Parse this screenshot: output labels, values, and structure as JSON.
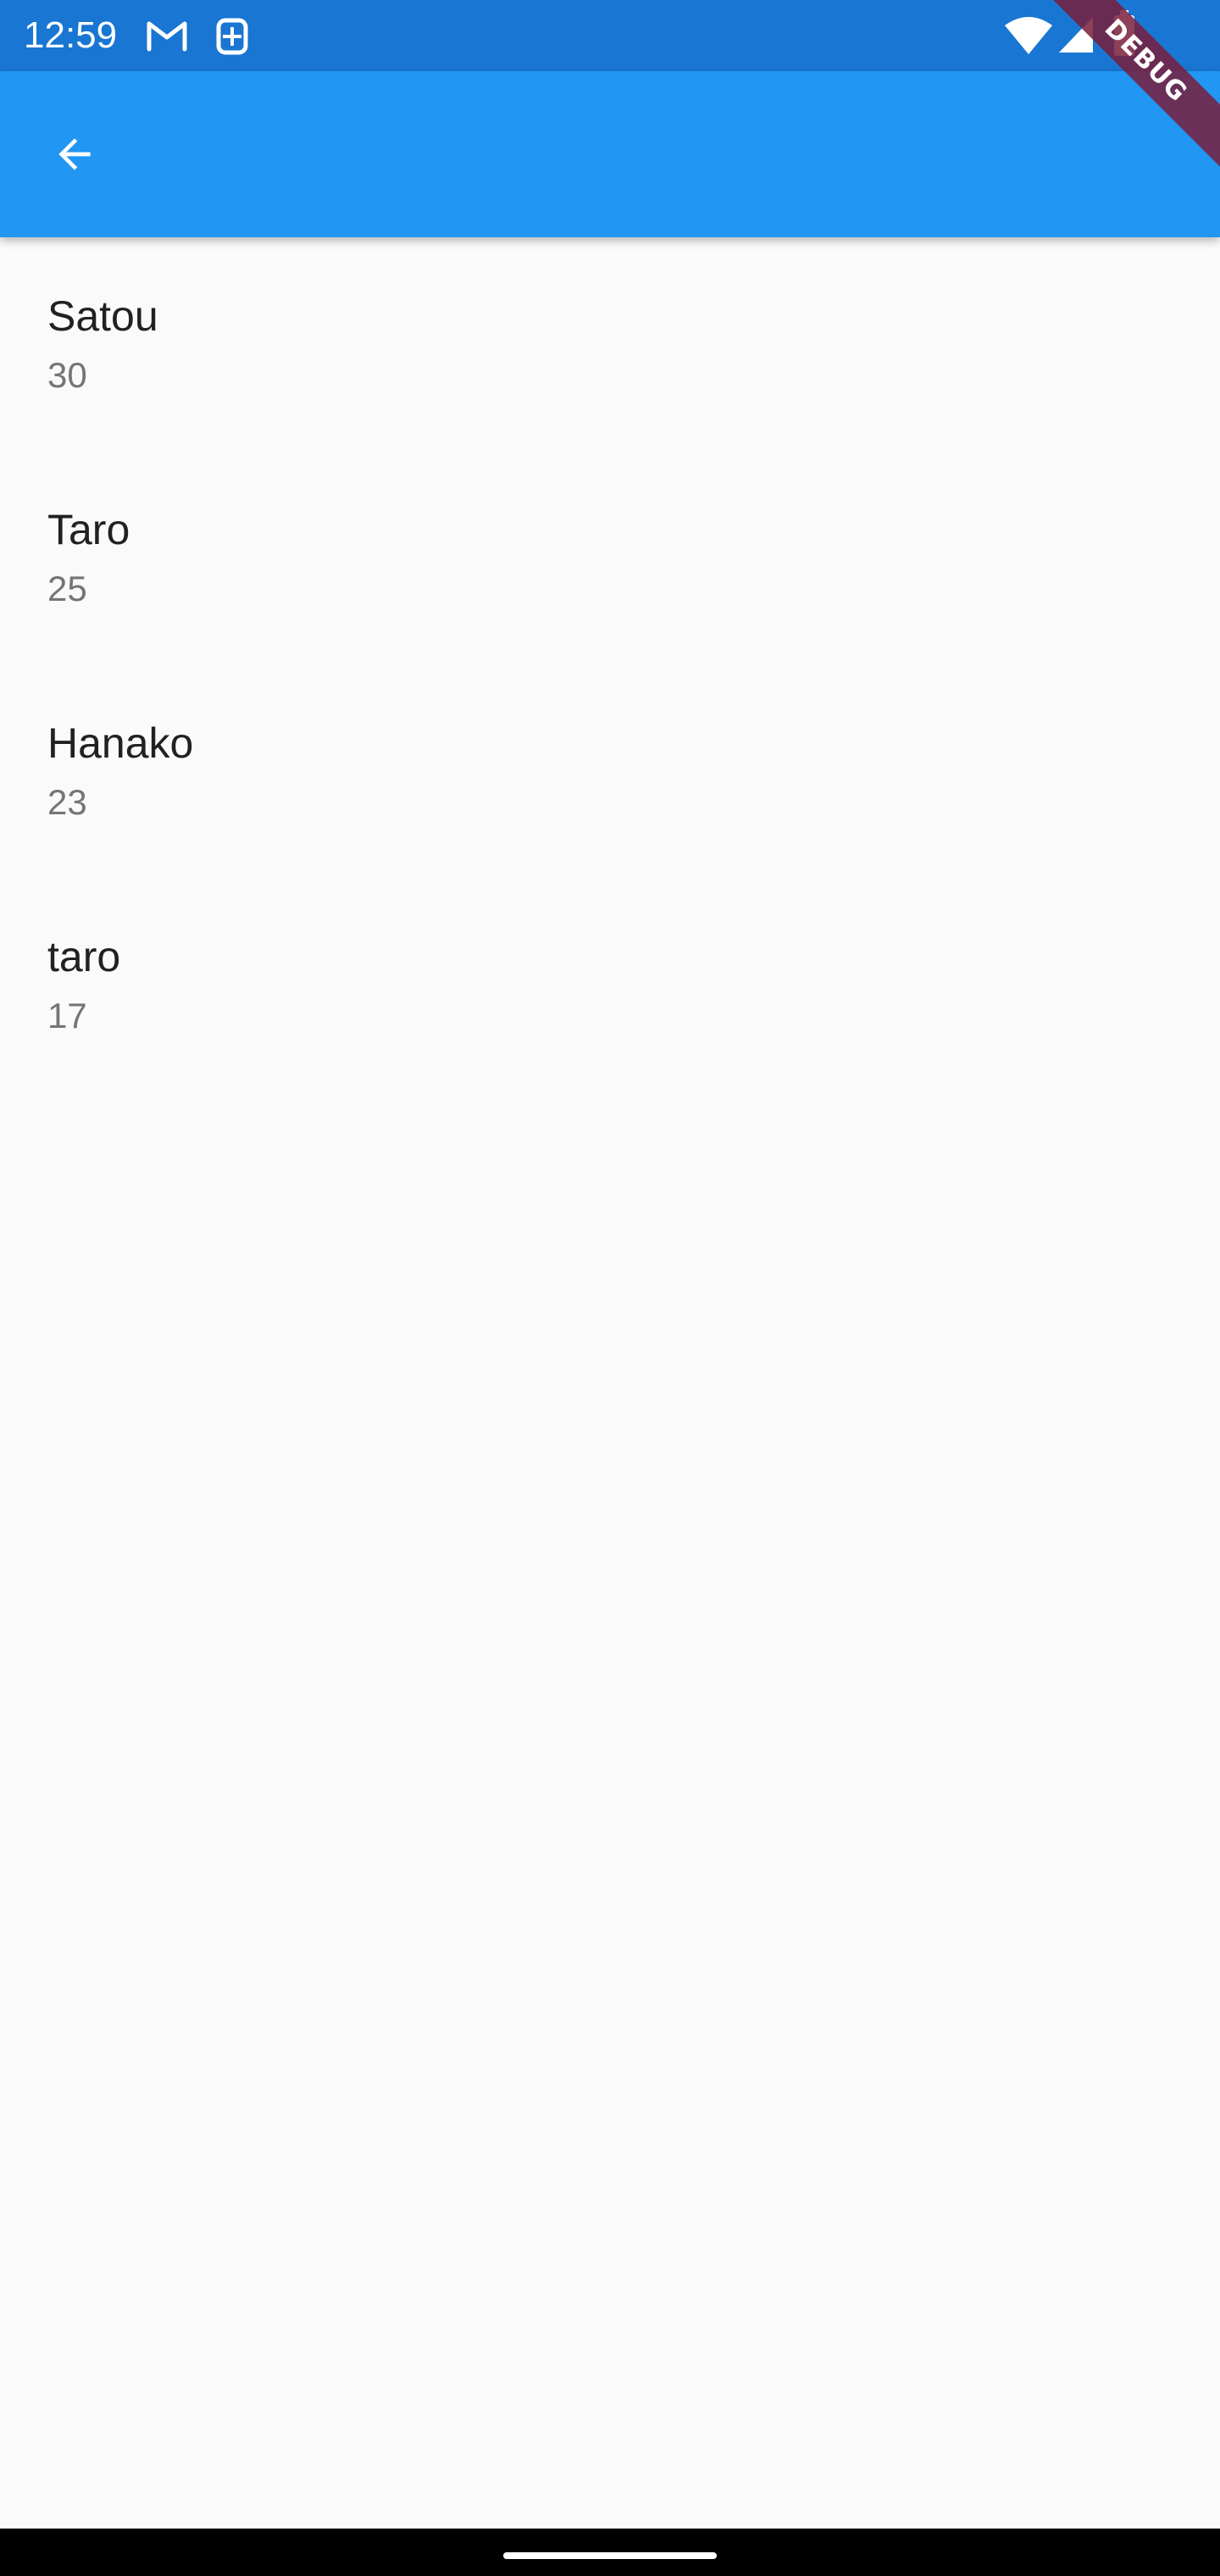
{
  "status_bar": {
    "time": "12:59",
    "background_color": "#1976D2",
    "left_icons": [
      "gmail-icon",
      "sim-card-icon"
    ],
    "right_icons": [
      "wifi-icon",
      "cellular-signal-icon",
      "battery-icon"
    ]
  },
  "app_bar": {
    "background_color": "#2196F3",
    "back_icon": "arrow-back-icon"
  },
  "debug_banner": {
    "label": "DEBUG"
  },
  "people": [
    {
      "name": "Satou",
      "age": "30"
    },
    {
      "name": "Taro",
      "age": "25"
    },
    {
      "name": "Hanako",
      "age": "23"
    },
    {
      "name": "taro",
      "age": "17"
    }
  ]
}
